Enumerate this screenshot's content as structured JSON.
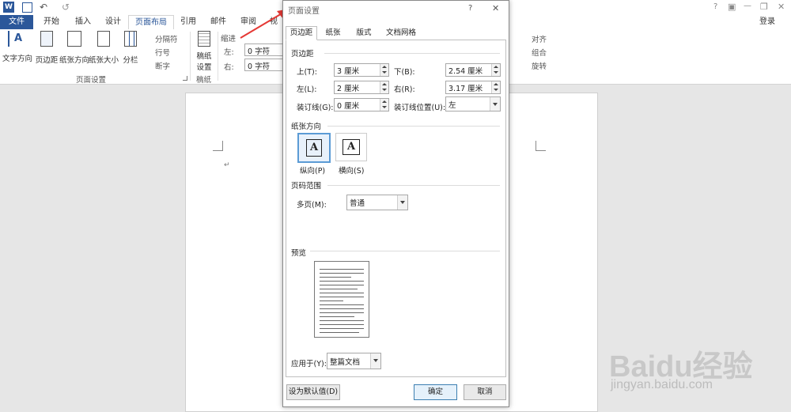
{
  "window": {
    "login_label": "登录",
    "help_glyph": "?",
    "ribbon_display_glyph": "▣",
    "min_glyph": "—",
    "restore_glyph": "❐",
    "close_glyph": "✕"
  },
  "tabs": [
    {
      "label": "文件"
    },
    {
      "label": "开始"
    },
    {
      "label": "插入"
    },
    {
      "label": "设计"
    },
    {
      "label": "页面布局"
    },
    {
      "label": "引用"
    },
    {
      "label": "邮件"
    },
    {
      "label": "审阅"
    },
    {
      "label": "视"
    }
  ],
  "ribbon": {
    "text_direction": "文字方向",
    "margins": "页边距",
    "orientation": "纸张方向",
    "size": "纸张大小",
    "columns": "分栏",
    "breaks": "分隔符",
    "line_numbers": "行号",
    "hyphenation": "断字",
    "group_page_setup": "页面设置",
    "manuscript_1": "稿纸",
    "manuscript_2": "设置",
    "group_manuscript": "稿纸",
    "indent_label": "缩进",
    "indent_left_label": "左:",
    "indent_left_value": "0 字符",
    "indent_right_label": "右:",
    "indent_right_value": "0 字符",
    "align": "对齐",
    "group": "组合",
    "rotate": "旋转"
  },
  "dialog": {
    "title": "页面设置",
    "help": "?",
    "close": "✕",
    "tabs": [
      {
        "label": "页边距"
      },
      {
        "label": "纸张"
      },
      {
        "label": "版式"
      },
      {
        "label": "文档网格"
      }
    ],
    "margins_group": "页边距",
    "top_label": "上(T):",
    "top_value": "3 厘米",
    "bottom_label": "下(B):",
    "bottom_value": "2.54 厘米",
    "left_label": "左(L):",
    "left_value": "2 厘米",
    "right_label": "右(R):",
    "right_value": "3.17 厘米",
    "gutter_label": "装订线(G):",
    "gutter_value": "0 厘米",
    "gutter_pos_label": "装订线位置(U):",
    "gutter_pos_value": "左",
    "orientation_group": "纸张方向",
    "portrait_label": "纵向(P)",
    "landscape_label": "横向(S)",
    "orientation_glyph": "A",
    "pages_group": "页码范围",
    "multiple_pages_label": "多页(M):",
    "multiple_pages_value": "普通",
    "preview_group": "预览",
    "apply_label": "应用于(Y):",
    "apply_value": "整篇文档",
    "default_button": "设为默认值(D)",
    "ok_button": "确定",
    "cancel_button": "取消"
  },
  "watermark": {
    "brand": "Baidu经验",
    "url": "jingyan.baidu.com"
  },
  "colors": {
    "accent": "#2b579a",
    "arrow": "#e53935"
  }
}
